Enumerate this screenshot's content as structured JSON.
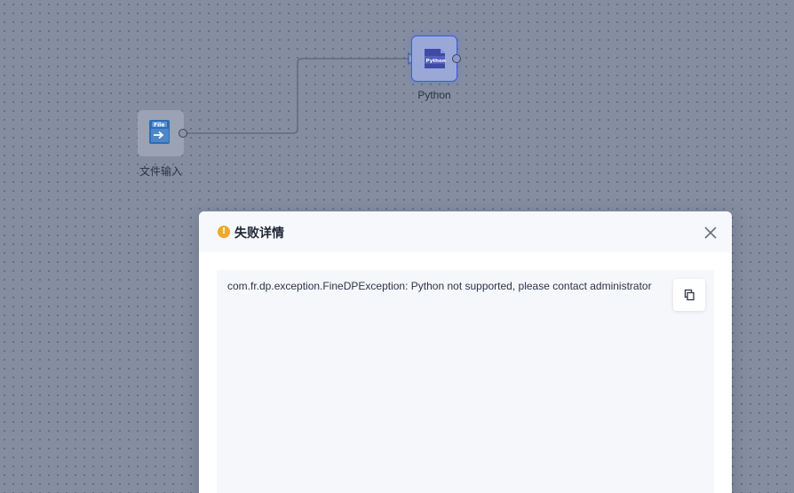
{
  "canvas": {
    "nodes": [
      {
        "id": "file-input",
        "icon_text": "File",
        "label": "文件输入"
      },
      {
        "id": "python",
        "icon_text": "Python",
        "label": "Python"
      }
    ]
  },
  "dialog": {
    "title": "失败详情",
    "warning_symbol": "!",
    "message": "com.fr.dp.exception.FineDPException: Python not supported, please contact administrator",
    "icons": {
      "warning": "warning-icon",
      "close": "close-icon",
      "copy": "copy-icon"
    }
  },
  "colors": {
    "canvas_bg": "#858ea1",
    "selected_border": "#3d5bd6",
    "warning": "#f0a92a",
    "file_icon": "#2d6fb5",
    "python_icon": "#4a55b0"
  }
}
